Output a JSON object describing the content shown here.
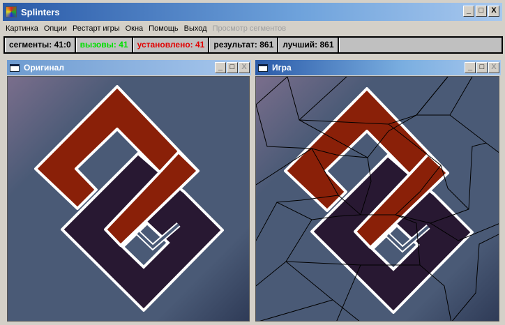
{
  "window": {
    "title": "Splinters",
    "buttons": {
      "minimize": "_",
      "maximize": "□",
      "close": "X"
    }
  },
  "menu": [
    {
      "label": "Картинка"
    },
    {
      "label": "Опции"
    },
    {
      "label": "Рестарт игры"
    },
    {
      "label": "Окна"
    },
    {
      "label": "Помощь"
    },
    {
      "label": "Выход"
    },
    {
      "label": "Просмотр сегментов",
      "disabled": true
    }
  ],
  "status": {
    "segments": "сегменты: 41:0",
    "calls": "вызовы: 41",
    "installed": "установлено: 41",
    "result": "результат: 861",
    "best": "лучший: 861",
    "calls_color": "#00e000",
    "installed_color": "#e00000"
  },
  "panels": {
    "original": {
      "title": "Оригинал"
    },
    "game": {
      "title": "Игра"
    }
  },
  "colors": {
    "red": "#8a2008",
    "purple": "#281832",
    "bg": "#4a5a76"
  }
}
